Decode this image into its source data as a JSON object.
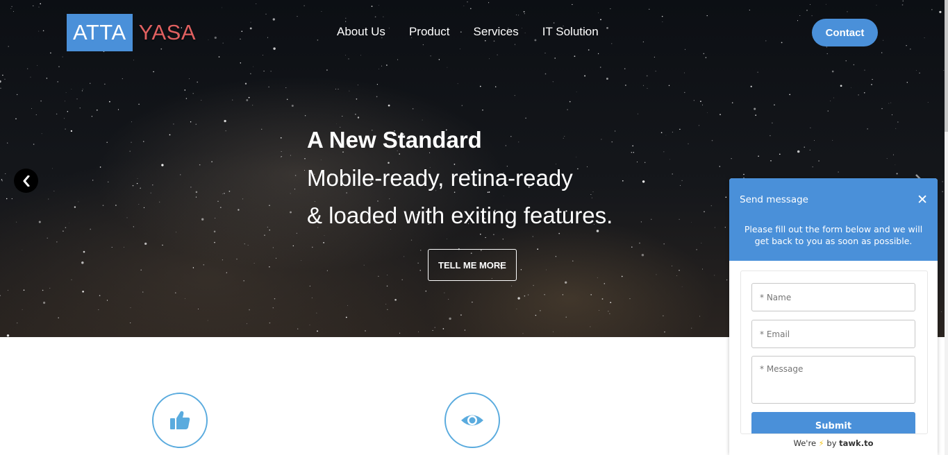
{
  "logo": {
    "part1": "ATTA",
    "part2": "YASA"
  },
  "nav": {
    "items": [
      "About Us",
      "Product",
      "Services",
      "IT Solution"
    ]
  },
  "contact_label": "Contact",
  "hero": {
    "title": "A New Standard",
    "line1": "Mobile-ready, retina-ready",
    "line2": "& loaded with exiting features.",
    "button": "TELL ME MORE"
  },
  "icons": {
    "prev": "chevron-left-icon",
    "next": "chevron-right-icon",
    "feature1": "thumbs-up-icon",
    "feature2": "eye-icon"
  },
  "colors": {
    "accent": "#4a90d9",
    "logo_red": "#e06060",
    "feature_ring": "#5aabde"
  },
  "chat": {
    "title": "Send message",
    "subtitle": "Please fill out the form below and we will get back to you as soon as possible.",
    "name_placeholder": "* Name",
    "email_placeholder": "* Email",
    "message_placeholder": "* Message",
    "submit": "Submit",
    "footer_pre": "We're",
    "footer_by": "by",
    "footer_brand": "tawk.to"
  }
}
